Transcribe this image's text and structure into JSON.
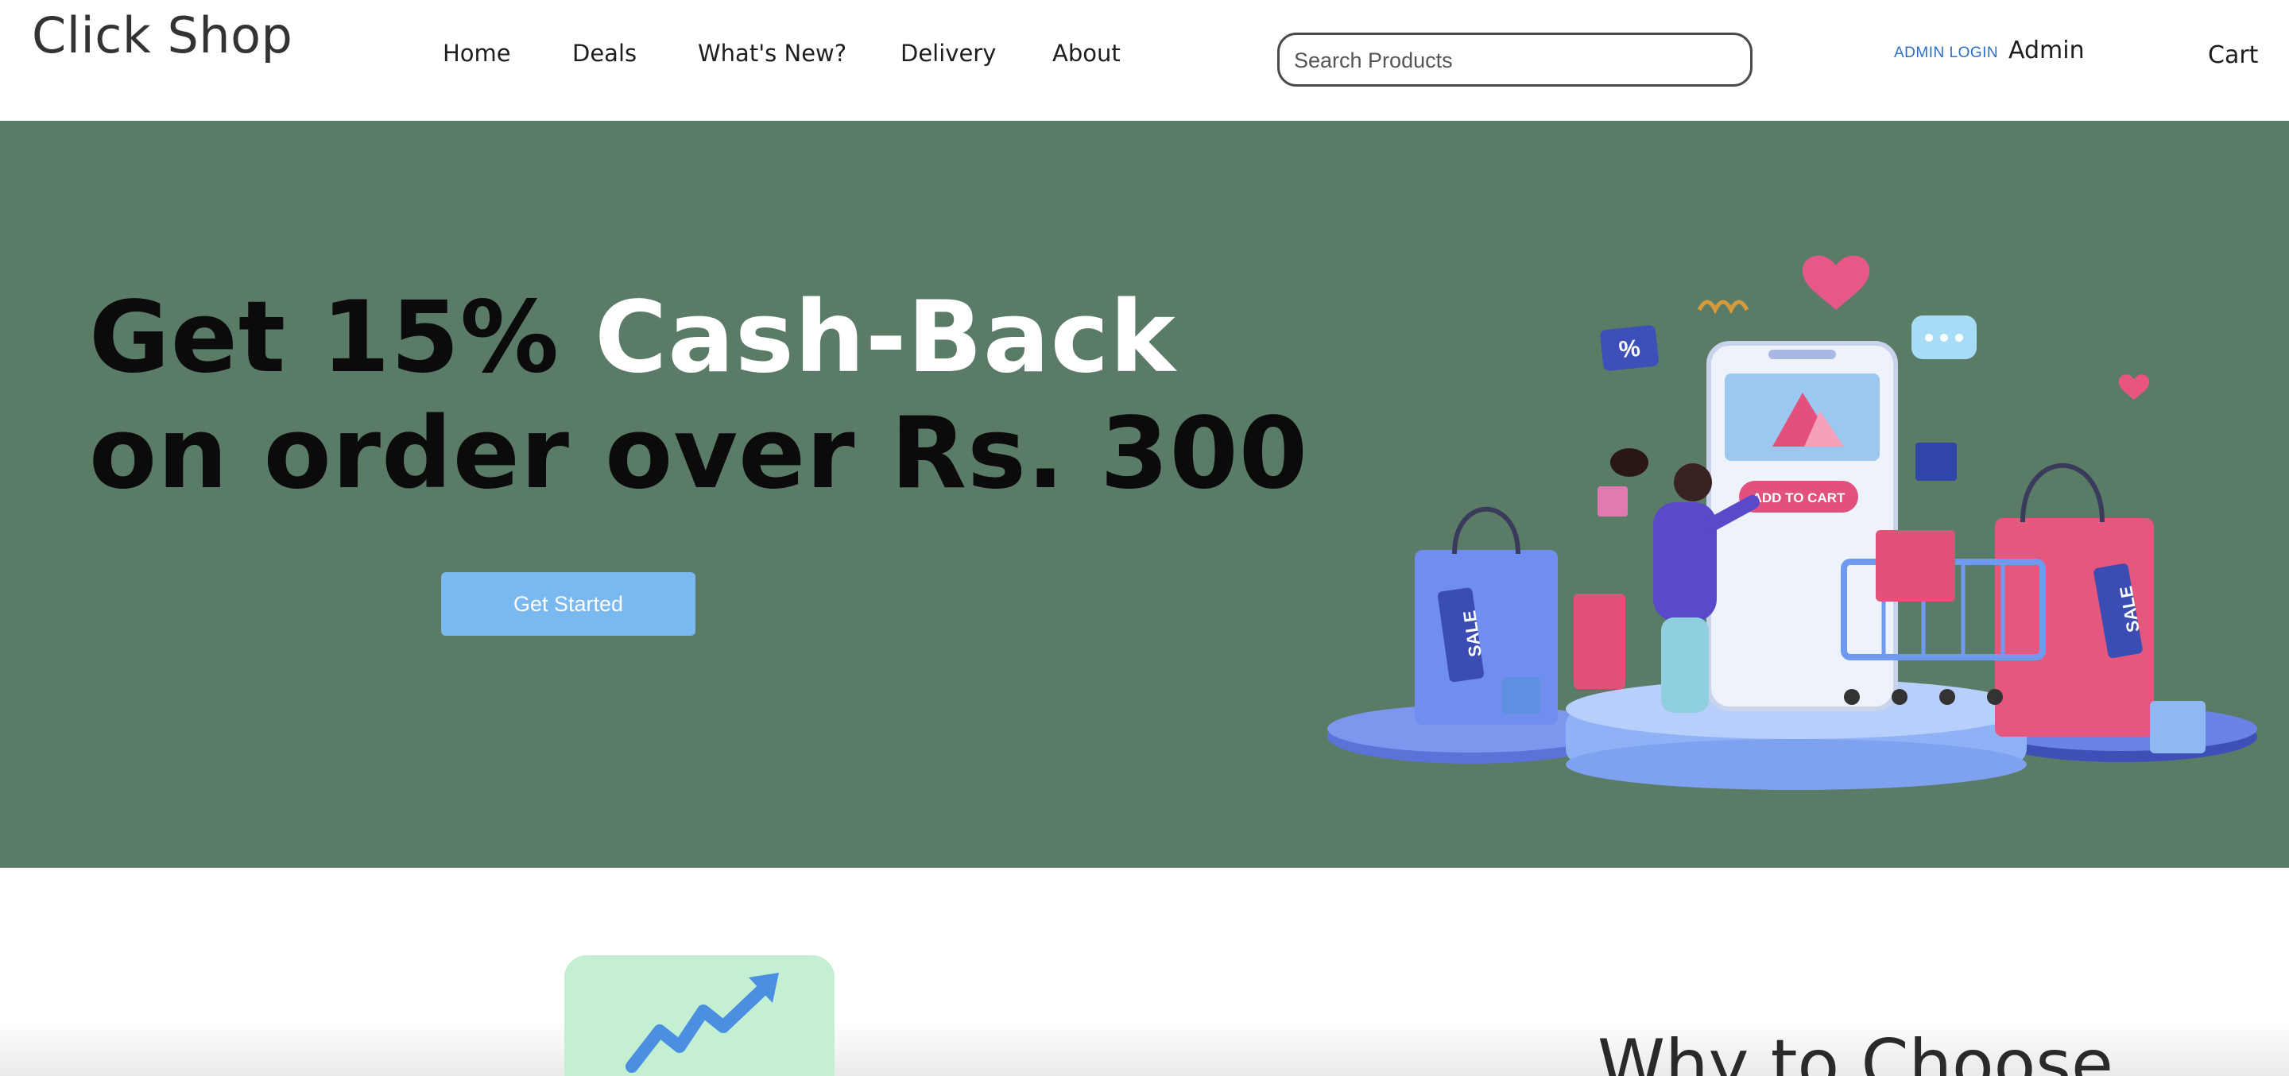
{
  "header": {
    "logo": "Click Shop",
    "nav": [
      {
        "label": "Home"
      },
      {
        "label": "Deals"
      },
      {
        "label": "What's New?"
      },
      {
        "label": "Delivery"
      },
      {
        "label": "About"
      }
    ],
    "search": {
      "placeholder": "Search Products",
      "value": ""
    },
    "admin_login": "ADMIN LOGIN",
    "admin": "Admin",
    "cart": "Cart"
  },
  "hero": {
    "headline_part1": "Get 15% ",
    "headline_part2": "Cash-Back",
    "headline_line2": "on order over Rs. 300",
    "cta": "Get Started",
    "illustration": {
      "phone_button": "ADD TO CART",
      "percent_bubble": "%",
      "sale_tag_left": "SALE",
      "sale_tag_right": "SALE"
    }
  },
  "features": {
    "why_title": "Why to Choose",
    "card_icon": "trend-up-arrow-icon"
  },
  "colors": {
    "hero_bg": "#5a7c67",
    "cta_bg": "#7ab8f0",
    "card_bg": "#c5efd3",
    "link_blue": "#2b6fc7"
  }
}
